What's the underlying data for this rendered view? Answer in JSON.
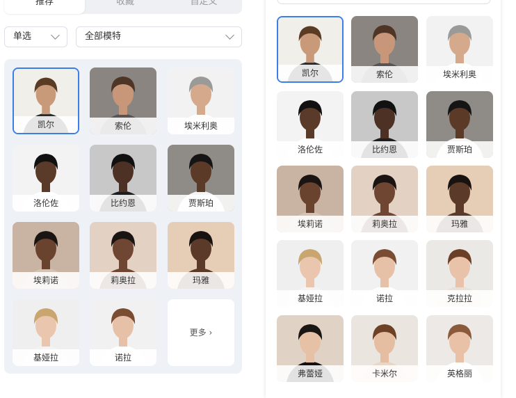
{
  "tabs": [
    "推荐",
    "收藏",
    "自定义"
  ],
  "filters": {
    "selection_mode": "单选",
    "category": "全部模特"
  },
  "left_models": [
    {
      "name": "凯尔",
      "bg": "#f1efe9",
      "skin": "#c99a7a",
      "hair": "#5a3c24",
      "shirt": "#2b2b2b"
    },
    {
      "name": "索伦",
      "bg": "#8a8580",
      "skin": "#c8977a",
      "hair": "#4e3526",
      "shirt": "#555"
    },
    {
      "name": "埃米利奥",
      "bg": "#f2f2f2",
      "skin": "#d5a98c",
      "hair": "#9a9a98",
      "shirt": "#ffffff"
    },
    {
      "name": "洛伦佐",
      "bg": "#f3f3f3",
      "skin": "#5a3a28",
      "hair": "#111",
      "shirt": "#ffffff"
    },
    {
      "name": "比约恩",
      "bg": "#c8c8c8",
      "skin": "#4d3124",
      "hair": "#111",
      "shirt": "#1e1e1e"
    },
    {
      "name": "贾斯珀",
      "bg": "#8f8b86",
      "skin": "#5b3a28",
      "hair": "#151515",
      "shirt": "#f4f4f4"
    },
    {
      "name": "埃莉诺",
      "bg": "#c9b3a2",
      "skin": "#6a432f",
      "hair": "#1a1412",
      "shirt": "#d4c2b4"
    },
    {
      "name": "莉奥拉",
      "bg": "#e3d2c4",
      "skin": "#6e4632",
      "hair": "#1a1412",
      "shirt": "#6e4632"
    },
    {
      "name": "玛雅",
      "bg": "#e6cdb6",
      "skin": "#5c3a29",
      "hair": "#181210",
      "shirt": "#5c3a29"
    },
    {
      "name": "基娅拉",
      "bg": "#efefef",
      "skin": "#eac6ae",
      "hair": "#c9a66f",
      "shirt": "#f3f3f3"
    },
    {
      "name": "诺拉",
      "bg": "#f1f1f1",
      "skin": "#e7c0a8",
      "hair": "#7a4d32",
      "shirt": "#ffffff"
    }
  ],
  "more_label": "更多",
  "right_models": [
    {
      "name": "凯尔",
      "bg": "#f1efe9",
      "skin": "#c99a7a",
      "hair": "#5a3c24",
      "shirt": "#2b2b2b"
    },
    {
      "name": "索伦",
      "bg": "#8a8580",
      "skin": "#c8977a",
      "hair": "#4e3526",
      "shirt": "#555"
    },
    {
      "name": "埃米利奥",
      "bg": "#f2f2f2",
      "skin": "#d5a98c",
      "hair": "#9a9a98",
      "shirt": "#ffffff"
    },
    {
      "name": "洛伦佐",
      "bg": "#f3f3f3",
      "skin": "#5a3a28",
      "hair": "#111",
      "shirt": "#ffffff"
    },
    {
      "name": "比约恩",
      "bg": "#c8c8c8",
      "skin": "#4d3124",
      "hair": "#111",
      "shirt": "#1e1e1e"
    },
    {
      "name": "贾斯珀",
      "bg": "#8f8b86",
      "skin": "#5b3a28",
      "hair": "#151515",
      "shirt": "#f4f4f4"
    },
    {
      "name": "埃莉诺",
      "bg": "#c9b3a2",
      "skin": "#6a432f",
      "hair": "#1a1412",
      "shirt": "#d4c2b4"
    },
    {
      "name": "莉奥拉",
      "bg": "#e3d2c4",
      "skin": "#6e4632",
      "hair": "#1a1412",
      "shirt": "#6e4632"
    },
    {
      "name": "玛雅",
      "bg": "#e6cdb6",
      "skin": "#5c3a29",
      "hair": "#181210",
      "shirt": "#5c3a29"
    },
    {
      "name": "基娅拉",
      "bg": "#efefef",
      "skin": "#eac6ae",
      "hair": "#c9a66f",
      "shirt": "#f3f3f3"
    },
    {
      "name": "诺拉",
      "bg": "#f1f1f1",
      "skin": "#e7c0a8",
      "hair": "#7a4d32",
      "shirt": "#ffffff"
    },
    {
      "name": "克拉拉",
      "bg": "#ebe9e6",
      "skin": "#e9c2aa",
      "hair": "#6b3f27",
      "shirt": "#e8e0d8"
    },
    {
      "name": "弗蕾娅",
      "bg": "#e0d3c6",
      "skin": "#e6c1a5",
      "hair": "#1a1614",
      "shirt": "#111111"
    },
    {
      "name": "卡米尔",
      "bg": "#ebe5df",
      "skin": "#e5bea2",
      "hair": "#6e4026",
      "shirt": "#e8d7c6"
    },
    {
      "name": "英格丽",
      "bg": "#ece9e6",
      "skin": "#e8c1a6",
      "hair": "#8a5a3a",
      "shirt": "#ffffff"
    }
  ],
  "selected_model": "凯尔",
  "colors": {
    "accent": "#3b7de9",
    "panel_bg": "#eef2f7"
  }
}
